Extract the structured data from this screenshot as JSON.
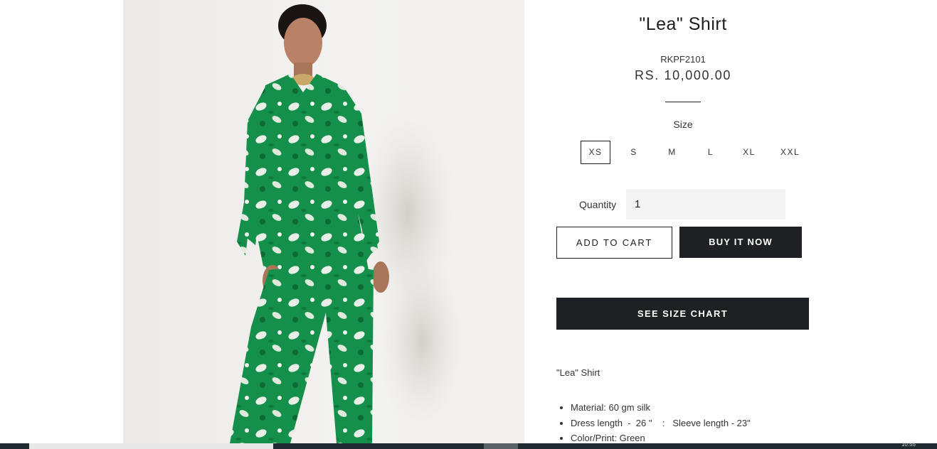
{
  "product": {
    "title": "\"Lea\" Shirt",
    "sku": "RKPF2101",
    "price": "RS. 10,000.00",
    "image_alt": "model wearing green floral printed shirt and trousers"
  },
  "size": {
    "label": "Size",
    "options": [
      "XS",
      "S",
      "M",
      "L",
      "XL",
      "XXL"
    ],
    "selected": "XS"
  },
  "quantity": {
    "label": "Quantity",
    "value": "1"
  },
  "buttons": {
    "add_to_cart": "ADD TO CART",
    "buy_it_now": "BUY IT NOW",
    "see_size_chart": "SEE SIZE CHART"
  },
  "description": {
    "title": "\"Lea\" Shirt",
    "bullets": [
      "Material: 60 gm silk",
      "Dress length  -  26 \"    :   Sleeve length - 23\"",
      "Color/Print: Green"
    ]
  },
  "taskbar": {
    "clock": "10:55"
  },
  "colors": {
    "text": "#1c1d1d",
    "button_dark": "#1f2023",
    "input_bg": "#f4f4f4",
    "print_green": "#15914a"
  }
}
